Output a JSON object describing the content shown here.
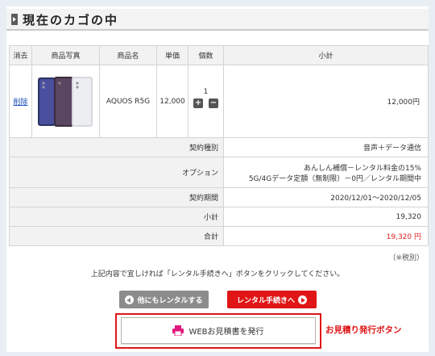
{
  "header": {
    "title": "現在のカゴの中"
  },
  "table": {
    "columns": [
      "消去",
      "商品写真",
      "商品名",
      "単価",
      "個数",
      "小計"
    ],
    "item": {
      "delete_label": "削除",
      "name": "AQUOS R5G",
      "unit_price": "12,000",
      "quantity": "1",
      "plus_label": "+",
      "minus_label": "−",
      "subtotal": "12,000円"
    },
    "details": [
      {
        "label": "契約種別",
        "value": "音声＋データ通信"
      },
      {
        "label": "オプション",
        "value_line1": "あんしん補償－レンタル料金の15%",
        "value_line2": "5G/4Gデータ定額（無制限）－0円／レンタル期間中"
      },
      {
        "label": "契約期間",
        "value": "2020/12/01～2020/12/05"
      },
      {
        "label": "小計",
        "value": "19,320"
      },
      {
        "label": "合計",
        "value": "19,320 円"
      }
    ],
    "tax_note": "（※税別）"
  },
  "notice": "上記内容で宜しければ「レンタル手続きへ」ボタンをクリックしてください。",
  "buttons": {
    "more_rental": "他にもレンタルする",
    "proceed": "レンタル手続きへ",
    "web_quote": "WEBお見積書を発行"
  },
  "callout": "お見積り発行ボタン",
  "colors": {
    "accent": "#e01515",
    "gray_button": "#8c8c8c",
    "link": "#1a4fb5"
  }
}
